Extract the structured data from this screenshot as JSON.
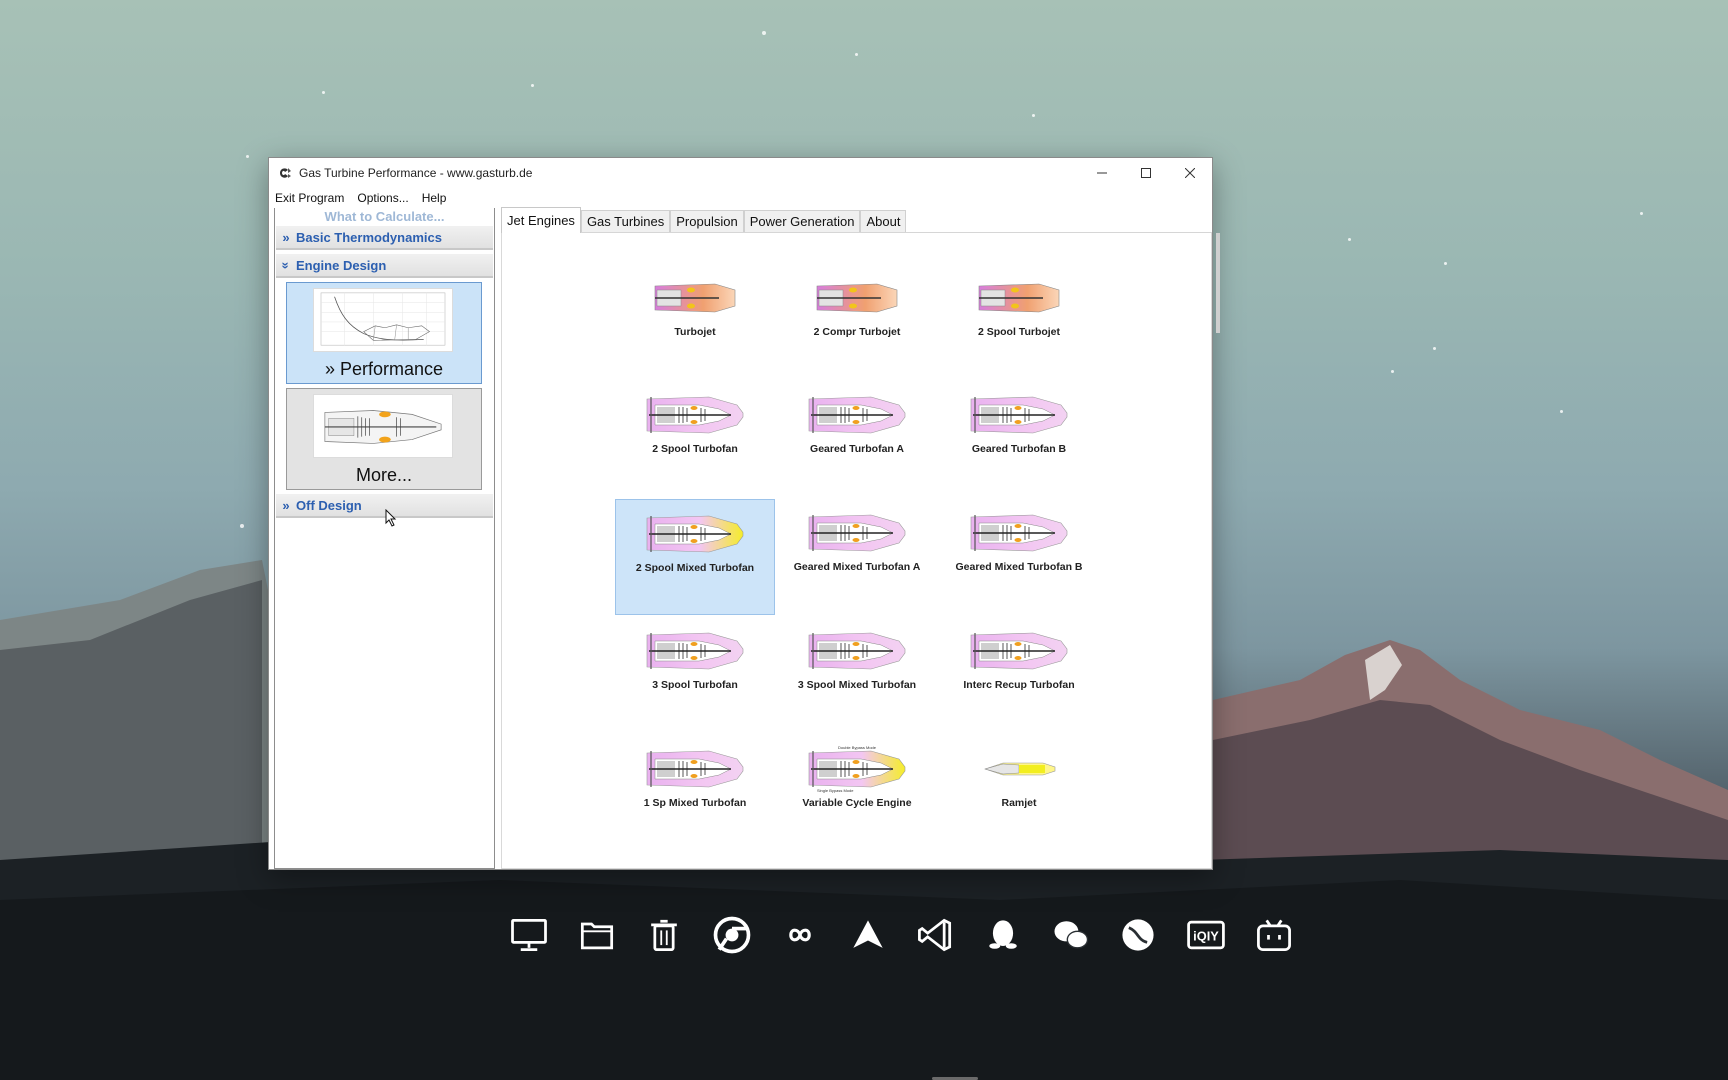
{
  "window": {
    "title": "Gas Turbine Performance  -  www.gasturb.de",
    "app_icon": "gasturb-logo-icon",
    "controls": [
      "minimize-icon",
      "maximize-icon",
      "close-icon"
    ]
  },
  "menu": {
    "exit": "Exit Program",
    "options": "Options...",
    "help": "Help"
  },
  "left_panel": {
    "heading": "What to Calculate...",
    "sections": [
      {
        "label": "Basic Thermodynamics",
        "chevron": "»",
        "state": "collapsed"
      },
      {
        "label": "Engine Design",
        "chevron": "»",
        "state": "expanded"
      },
      {
        "label": "Off Design",
        "chevron": "»",
        "state": "collapsed"
      }
    ],
    "cards": [
      {
        "label": "» Performance",
        "selected": true
      },
      {
        "label": "More...",
        "selected": false
      }
    ]
  },
  "tabs": [
    {
      "label": "Jet Engines",
      "active": true
    },
    {
      "label": "Gas Turbines",
      "active": false
    },
    {
      "label": "Propulsion",
      "active": false
    },
    {
      "label": "Power Generation",
      "active": false
    },
    {
      "label": "About",
      "active": false
    }
  ],
  "engines": [
    {
      "label": "Turbojet",
      "kind": "turbojet"
    },
    {
      "label": "2 Compr Turbojet",
      "kind": "turbojet"
    },
    {
      "label": "2 Spool Turbojet",
      "kind": "turbojet"
    },
    {
      "label": "2 Spool Turbofan",
      "kind": "turbofan"
    },
    {
      "label": "Geared Turbofan A",
      "kind": "turbofan"
    },
    {
      "label": "Geared Turbofan B",
      "kind": "turbofan"
    },
    {
      "label": "2 Spool Mixed Turbofan",
      "kind": "mixed",
      "selected": true
    },
    {
      "label": "Geared Mixed Turbofan A",
      "kind": "turbofan"
    },
    {
      "label": "Geared Mixed Turbofan B",
      "kind": "turbofan"
    },
    {
      "label": "3 Spool Turbofan",
      "kind": "turbofan"
    },
    {
      "label": "3 Spool Mixed Turbofan",
      "kind": "turbofan"
    },
    {
      "label": "Interc Recup Turbofan",
      "kind": "turbofan"
    },
    {
      "label": "1 Sp Mixed Turbofan",
      "kind": "turbofan"
    },
    {
      "label": "Variable Cycle Engine",
      "kind": "mixed",
      "notes": [
        "Double Bypass Mode",
        "Single Bypass Mode"
      ]
    },
    {
      "label": "Ramjet",
      "kind": "ramjet"
    }
  ],
  "taskbar": [
    "monitor-icon",
    "folder-icon",
    "trash-icon",
    "chrome-icon",
    "infinity-icon",
    "paper-plane-icon",
    "vscode-icon",
    "qq-penguin-icon",
    "wechat-icon",
    "ball-icon",
    "iqiyi-icon",
    "bilibili-icon"
  ],
  "iqiyi_text": "iQIY"
}
